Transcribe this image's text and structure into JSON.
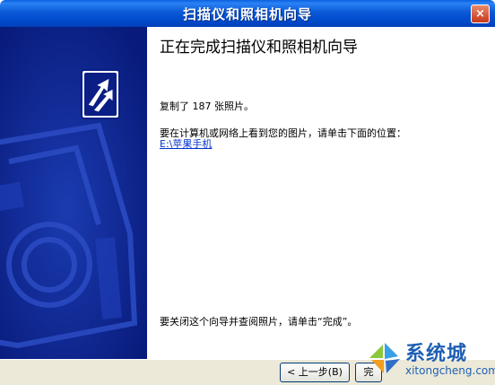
{
  "window": {
    "title": "扫描仪和照相机向导",
    "close_label": "×"
  },
  "content": {
    "heading": "正在完成扫描仪和照相机向导",
    "copied_text": "复制了 187 张照片。",
    "view_prompt": "要在计算机或网络上看到您的图片，请单击下面的位置：",
    "location_link": "E:\\苹果手机",
    "finish_note": "要关闭这个向导并查阅照片，请单击“完成”。"
  },
  "buttons": {
    "back_label": "< 上一步(B)",
    "finish_label": "完"
  },
  "watermark": {
    "name": "系统城",
    "url": "xitongcheng.com"
  },
  "colors": {
    "title_bar": "#0a59d8",
    "side_panel": "#0a1e86",
    "link": "#0033cc",
    "watermark": "#1f5fb5"
  },
  "icons": [
    "wizard-arrows-icon",
    "camera-graphic",
    "close-icon",
    "watermark-logo-icon"
  ]
}
